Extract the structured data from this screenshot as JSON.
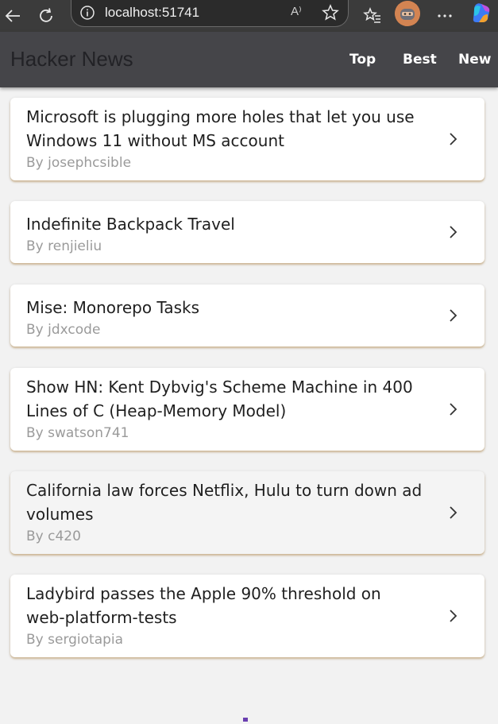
{
  "browser": {
    "url": "localhost:51741",
    "reader_label": "A⁾",
    "icons": [
      "back-icon",
      "refresh-icon",
      "info-icon",
      "read-aloud-icon",
      "favorite-star-icon",
      "favorites-list-icon",
      "profile-avatar",
      "more-icon",
      "copilot-icon"
    ]
  },
  "header": {
    "title": "Hacker News",
    "nav": [
      "Top",
      "Best",
      "New"
    ]
  },
  "stories": [
    {
      "title": "Microsoft is plugging more holes that let you use Windows 11 without MS account",
      "author": "By josephcsible"
    },
    {
      "title": "Indefinite Backpack Travel",
      "author": "By renjieliu"
    },
    {
      "title": "Mise: Monorepo Tasks",
      "author": "By jdxcode"
    },
    {
      "title": "Show HN: Kent Dybvig's Scheme Machine in 400 Lines of C (Heap-Memory Model)",
      "author": "By swatson741"
    },
    {
      "title": "California law forces Netflix, Hulu to turn down ad volumes",
      "author": "By c420"
    },
    {
      "title": "Ladybird passes the Apple 90% threshold on web-platform-tests",
      "author": "By sergiotapia"
    }
  ],
  "colors": {
    "header_bg": "#454549",
    "card_shadow": "#be965a",
    "loader": "#6a3fb0"
  }
}
